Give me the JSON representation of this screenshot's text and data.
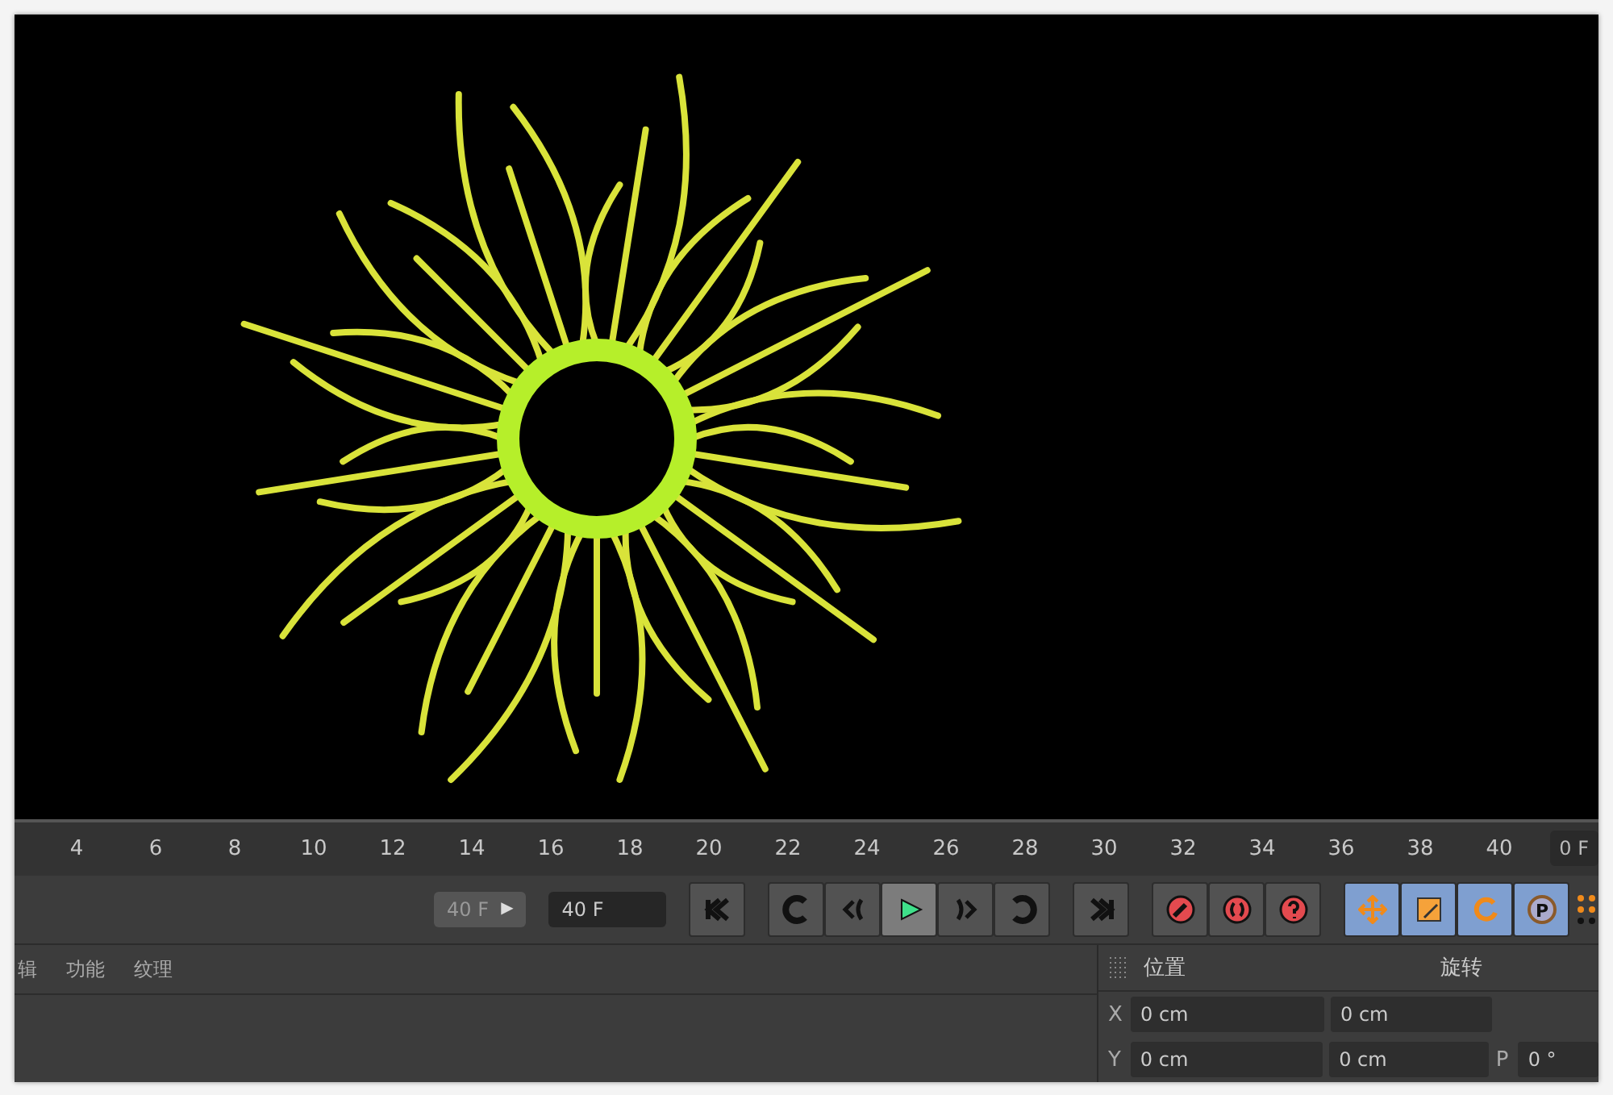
{
  "timeline": {
    "ticks": [
      "4",
      "6",
      "8",
      "10",
      "12",
      "14",
      "16",
      "18",
      "20",
      "22",
      "24",
      "26",
      "28",
      "30",
      "32",
      "34",
      "36",
      "38",
      "40"
    ],
    "current_frame": "0 F"
  },
  "playback": {
    "end_field": "40 F",
    "end_field_arrow": "▶",
    "max_field": "40 F",
    "transport": [
      {
        "kind": "start",
        "selected": false
      },
      {
        "kind": "prevkey",
        "selected": false
      },
      {
        "kind": "stepback",
        "selected": false
      },
      {
        "kind": "play",
        "selected": true
      },
      {
        "kind": "stepfwd",
        "selected": false
      },
      {
        "kind": "nextkey",
        "selected": false
      }
    ],
    "end_button": {
      "kind": "end"
    },
    "record": [
      {
        "kind": "key"
      },
      {
        "kind": "autokey"
      },
      {
        "kind": "help"
      }
    ],
    "modes": [
      {
        "kind": "move",
        "selected": true
      },
      {
        "kind": "scale",
        "selected": true
      },
      {
        "kind": "rotate",
        "selected": true
      },
      {
        "kind": "param",
        "selected": true,
        "glyph": "P"
      }
    ]
  },
  "material_panel": {
    "tabs": [
      {
        "label": "辑",
        "selected": false
      },
      {
        "label": "功能",
        "selected": false
      },
      {
        "label": "纹理",
        "selected": false
      }
    ]
  },
  "coordinates": {
    "position_title": "位置",
    "rotation_title": "旋转",
    "rows": [
      {
        "axis": "X",
        "position": "0 cm",
        "size": "0 cm"
      },
      {
        "axis": "Y",
        "position": "0 cm",
        "size": "0 cm",
        "rot_axis": "P",
        "rotation": "0 °"
      }
    ]
  }
}
